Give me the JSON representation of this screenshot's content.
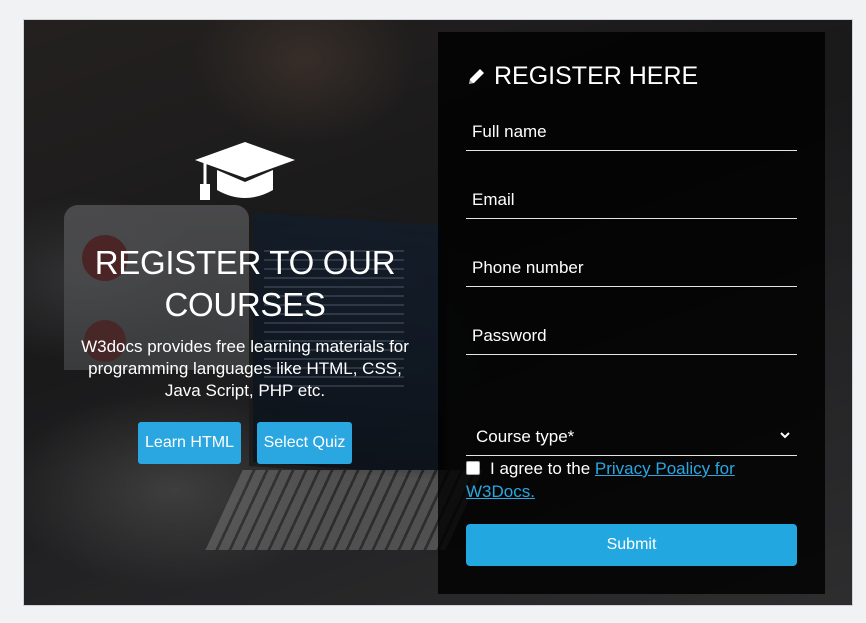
{
  "hero": {
    "title": "REGISTER TO OUR COURSES",
    "description": "W3docs provides free learning materials for programming languages like HTML, CSS, Java Script, PHP etc.",
    "buttons": {
      "learn_html": "Learn HTML",
      "select_quiz": "Select Quiz"
    }
  },
  "form": {
    "title": "REGISTER HERE",
    "fields": {
      "full_name": "Full name",
      "email": "Email",
      "phone": "Phone number",
      "password": "Password"
    },
    "course_select": "Course type*",
    "agree_text": "I agree to the ",
    "privacy_link": "Privacy Poalicy for W3Docs.",
    "submit": "Submit"
  },
  "colors": {
    "accent": "#22a7e0",
    "panel": "#000000"
  },
  "icons": {
    "hero": "graduation-cap-icon",
    "form": "pencil-icon",
    "select": "chevron-down-icon"
  }
}
